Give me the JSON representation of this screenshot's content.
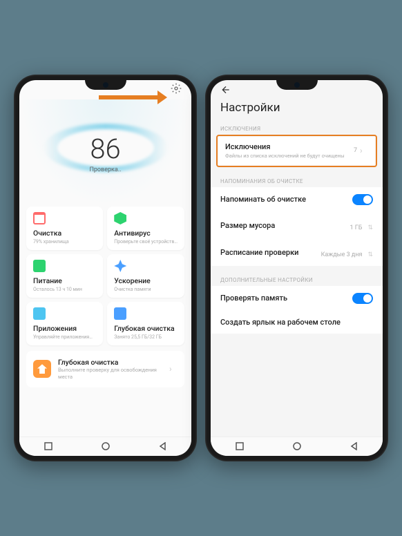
{
  "left": {
    "score": "86",
    "score_label": "Проверка..",
    "tiles": [
      {
        "title": "Очистка",
        "sub": "79% хранилища",
        "color": "#ff6b6b"
      },
      {
        "title": "Антивирус",
        "sub": "Проверьте своё устройств…",
        "color": "#2dd36f"
      },
      {
        "title": "Питание",
        "sub": "Осталось 13 ч 10 мин",
        "color": "#2dd36f"
      },
      {
        "title": "Ускорение",
        "sub": "Очистка памяти",
        "color": "#4a9fff"
      },
      {
        "title": "Приложения",
        "sub": "Управляйте приложения…",
        "color": "#4ec5f1"
      },
      {
        "title": "Глубокая очистка",
        "sub": "Занято 25,5 ГБ/32 ГБ",
        "color": "#4a9fff"
      }
    ],
    "deep": {
      "title": "Глубокая очистка",
      "sub": "Выполните проверку для освобождения места"
    }
  },
  "right": {
    "title": "Настройки",
    "section_exceptions": "ИСКЛЮЧЕНИЯ",
    "exceptions": {
      "title": "Исключения",
      "sub": "Файлы из списка исключений не будут очищены",
      "value": "7"
    },
    "section_reminders": "НАПОМИНАНИЯ ОБ ОЧИСТКЕ",
    "remind": "Напоминать об очистке",
    "trash_size": {
      "title": "Размер мусора",
      "value": "1 ГБ"
    },
    "schedule": {
      "title": "Расписание проверки",
      "value": "Каждые 3 дня"
    },
    "section_additional": "ДОПОЛНИТЕЛЬНЫЕ НАСТРОЙКИ",
    "check_mem": "Проверять память",
    "shortcut": "Создать ярлык на рабочем столе"
  }
}
